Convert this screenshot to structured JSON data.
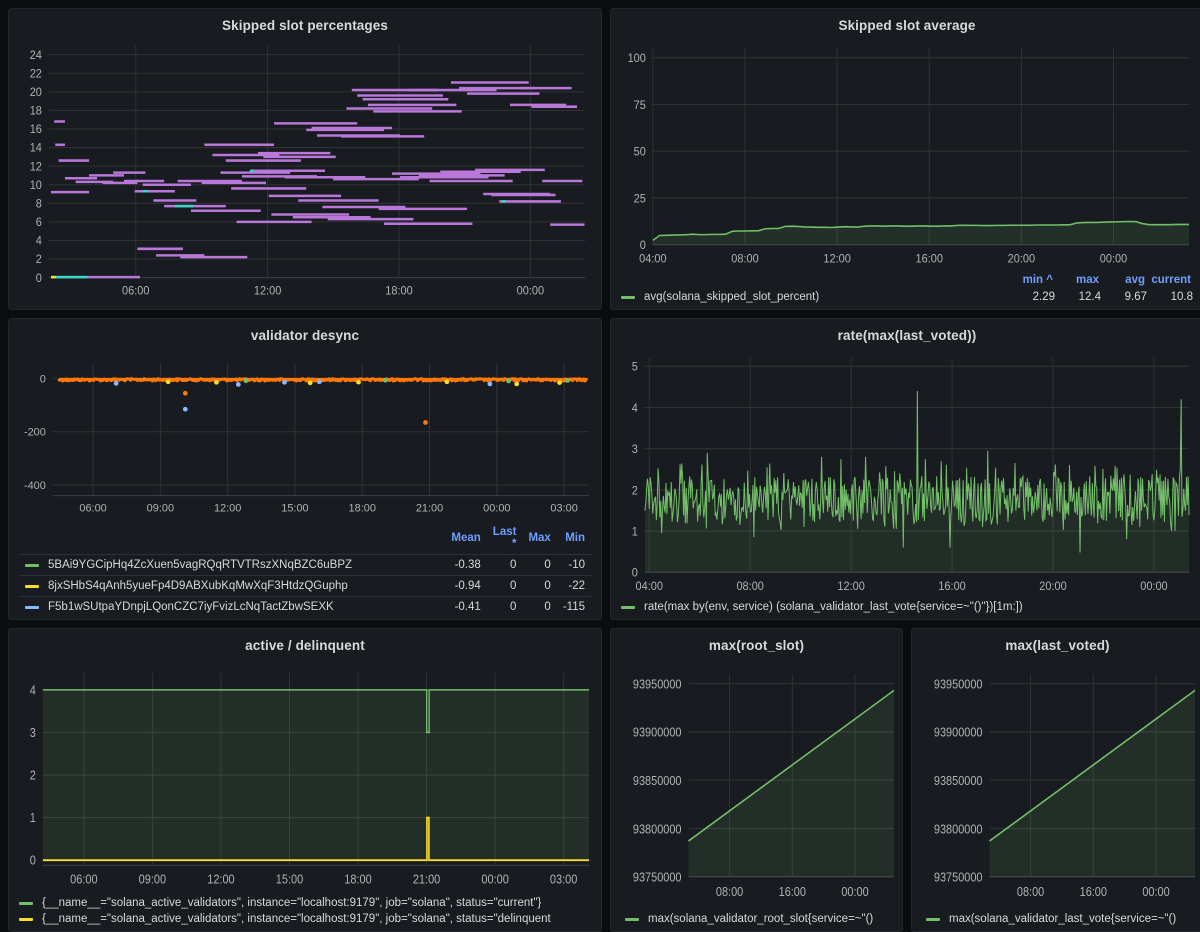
{
  "theme": {
    "page_bg": "#0b0c0e",
    "panel_bg": "#181b1f",
    "text": "#d8d9da",
    "accent_blue": "#6e9fff",
    "green": "#73bf69",
    "yellow": "#fade2a",
    "orange": "#ff780a",
    "blue": "#8ab8ff",
    "purple": "#b877d9",
    "cyan": "#37d9c4"
  },
  "panels": {
    "skipped_slot_percentages": {
      "title": "Skipped slot percentages"
    },
    "skipped_slot_average": {
      "title": "Skipped slot average"
    },
    "validator_desync": {
      "title": "validator desync"
    },
    "rate_max_last_voted": {
      "title": "rate(max(last_voted))"
    },
    "active_delinquent": {
      "title": "active / delinquent"
    },
    "max_root_slot": {
      "title": "max(root_slot)"
    },
    "max_last_voted": {
      "title": "max(last_voted)"
    }
  },
  "legends": {
    "skipped_slot_average": {
      "columns": [
        "min ^",
        "max",
        "avg",
        "current"
      ],
      "series": [
        {
          "label": "avg(solana_skipped_slot_percent)",
          "color": "#73bf69",
          "min": "2.29",
          "max": "12.4",
          "avg": "9.67",
          "current": "10.8"
        }
      ]
    },
    "validator_desync": {
      "columns": [
        "Mean",
        "Last *",
        "Max",
        "Min"
      ],
      "series": [
        {
          "label": "5BAi9YGCipHq4ZcXuen5vagRQqRTVTRszXNqBZC6uBPZ",
          "color": "#73bf69",
          "mean": "-0.38",
          "last": "0",
          "max": "0",
          "min": "-10"
        },
        {
          "label": "8jxSHbS4qAnh5yueFp4D9ABXubKqMwXqF3HtdzQGuphp",
          "color": "#fade2a",
          "mean": "-0.94",
          "last": "0",
          "max": "0",
          "min": "-22"
        },
        {
          "label": "F5b1wSUtpaYDnpjLQonCZC7iyFvizLcNqTactZbwSEXK",
          "color": "#8ab8ff",
          "mean": "-0.41",
          "last": "0",
          "max": "0",
          "min": "-115"
        }
      ]
    },
    "rate_max_last_voted": {
      "series": [
        {
          "label": "rate(max by(env, service) (solana_validator_last_vote{service=~\"()\"})[1m:])",
          "color": "#73bf69"
        }
      ]
    },
    "active_delinquent": {
      "series": [
        {
          "label": "{__name__=\"solana_active_validators\", instance=\"localhost:9179\", job=\"solana\", status=\"current\"}",
          "color": "#73bf69"
        },
        {
          "label": "{__name__=\"solana_active_validators\", instance=\"localhost:9179\", job=\"solana\", status=\"delinquent",
          "color": "#fade2a"
        }
      ]
    },
    "max_root_slot": {
      "series": [
        {
          "label": "max(solana_validator_root_slot{service=~\"()",
          "color": "#73bf69"
        }
      ]
    },
    "max_last_voted": {
      "series": [
        {
          "label": "max(solana_validator_last_vote{service=~\"()",
          "color": "#73bf69"
        }
      ]
    }
  },
  "chart_data": [
    {
      "id": "skipped_slot_percentages",
      "type": "scatter",
      "title": "Skipped slot percentages",
      "xlabel": "",
      "ylabel": "",
      "grid": true,
      "legend": "none",
      "ylim": [
        0,
        25
      ],
      "yticks": [
        0,
        2,
        4,
        6,
        8,
        10,
        12,
        14,
        16,
        18,
        20,
        22,
        24
      ],
      "xticks": [
        "06:00",
        "12:00",
        "18:00",
        "00:00"
      ],
      "xtick_positions": [
        0.162,
        0.408,
        0.653,
        0.898
      ],
      "colors": {
        "primary": "#b877d9",
        "secondary": "#37d9c4",
        "tertiary": "#fade2a"
      },
      "note": "Many short horizontal segments of per-validator skip rate; bulk of mass between 5 and 12 percent, drifting upward to 18-21 after 18:00",
      "series": [
        {
          "name": "band_main",
          "color": "#b877d9",
          "segments": [
            [
              0.004,
              0.075,
              9.2
            ],
            [
              0.01,
              0.03,
              16.8
            ],
            [
              0.012,
              0.03,
              14.3
            ],
            [
              0.018,
              0.075,
              12.6
            ],
            [
              0.03,
              0.09,
              10.7
            ],
            [
              0.05,
              0.12,
              10.3
            ],
            [
              0.075,
              0.14,
              11.0
            ],
            [
              0.1,
              0.165,
              10.2
            ],
            [
              0.12,
              0.18,
              11.3
            ],
            [
              0.14,
              0.215,
              10.4
            ],
            [
              0.16,
              0.235,
              9.3
            ],
            [
              0.165,
              0.25,
              3.1
            ],
            [
              0.175,
              0.265,
              10.0
            ],
            [
              0.195,
              0.275,
              8.3
            ],
            [
              0.2,
              0.29,
              2.4
            ],
            [
              0.215,
              0.33,
              7.7
            ],
            [
              0.24,
              0.36,
              10.4
            ],
            [
              0.245,
              0.37,
              2.2
            ],
            [
              0.265,
              0.395,
              7.2
            ],
            [
              0.285,
              0.405,
              10.2
            ],
            [
              0.29,
              0.42,
              14.3
            ],
            [
              0.305,
              0.43,
              13.2
            ],
            [
              0.32,
              0.45,
              11.3
            ],
            [
              0.33,
              0.47,
              12.6
            ],
            [
              0.34,
              0.48,
              9.6
            ],
            [
              0.35,
              0.49,
              6.0
            ],
            [
              0.36,
              0.5,
              10.9
            ],
            [
              0.375,
              0.515,
              11.5
            ],
            [
              0.39,
              0.525,
              13.4
            ],
            [
              0.4,
              0.535,
              13.0
            ],
            [
              0.41,
              0.545,
              8.8
            ],
            [
              0.415,
              0.56,
              6.8
            ],
            [
              0.42,
              0.575,
              16.6
            ],
            [
              0.44,
              0.59,
              10.8
            ],
            [
              0.455,
              0.6,
              6.5
            ],
            [
              0.465,
              0.615,
              8.3
            ],
            [
              0.48,
              0.625,
              15.9
            ],
            [
              0.49,
              0.64,
              16.1
            ],
            [
              0.5,
              0.655,
              15.3
            ],
            [
              0.51,
              0.665,
              7.6
            ],
            [
              0.52,
              0.68,
              6.3
            ],
            [
              0.53,
              0.69,
              10.6
            ],
            [
              0.545,
              0.7,
              15.2
            ],
            [
              0.555,
              0.715,
              18.2
            ],
            [
              0.565,
              0.725,
              20.2
            ],
            [
              0.575,
              0.735,
              19.6
            ],
            [
              0.585,
              0.745,
              19.2
            ],
            [
              0.595,
              0.76,
              18.6
            ],
            [
              0.605,
              0.77,
              17.9
            ],
            [
              0.615,
              0.78,
              7.4
            ],
            [
              0.625,
              0.79,
              5.8
            ],
            [
              0.64,
              0.805,
              11.2
            ],
            [
              0.655,
              0.82,
              10.8
            ],
            [
              0.67,
              0.835,
              20.2
            ],
            [
              0.69,
              0.85,
              11.0
            ],
            [
              0.71,
              0.865,
              10.4
            ],
            [
              0.73,
              0.88,
              11.4
            ],
            [
              0.75,
              0.895,
              21.0
            ],
            [
              0.765,
              0.905,
              20.4
            ],
            [
              0.78,
              0.915,
              19.8
            ],
            [
              0.795,
              0.925,
              11.6
            ],
            [
              0.81,
              0.935,
              9.0
            ],
            [
              0.825,
              0.945,
              8.9
            ],
            [
              0.84,
              0.955,
              8.2
            ],
            [
              0.86,
              0.965,
              18.6
            ],
            [
              0.88,
              0.975,
              20.4
            ],
            [
              0.9,
              0.985,
              18.4
            ],
            [
              0.92,
              0.995,
              10.4
            ],
            [
              0.935,
              0.999,
              5.7
            ]
          ]
        },
        {
          "name": "zero_line",
          "color": "#b877d9",
          "segments": [
            [
              0.004,
              0.17,
              0.05
            ]
          ]
        },
        {
          "name": "cyan_marks",
          "color": "#37d9c4",
          "segments": [
            [
              0.012,
              0.072,
              0.05
            ],
            [
              0.175,
              0.185,
              9.3
            ],
            [
              0.235,
              0.27,
              7.7
            ],
            [
              0.375,
              0.382,
              11.5
            ],
            [
              0.845,
              0.852,
              8.2
            ]
          ]
        },
        {
          "name": "yellow_marks",
          "color": "#fade2a",
          "segments": [
            [
              0.004,
              0.013,
              0.05
            ]
          ]
        }
      ]
    },
    {
      "id": "skipped_slot_average",
      "type": "area",
      "title": "Skipped slot average",
      "ylim": [
        0,
        105
      ],
      "yticks": [
        0,
        25,
        50,
        75,
        100
      ],
      "xticks": [
        "04:00",
        "08:00",
        "12:00",
        "16:00",
        "20:00",
        "00:00"
      ],
      "grid": true,
      "legend": "bottom",
      "series": [
        {
          "name": "avg(solana_skipped_slot_percent)",
          "color": "#73bf69",
          "values": [
            2.3,
            4.9,
            5.0,
            5.1,
            5.2,
            5.3,
            5.6,
            5.4,
            5.4,
            5.5,
            5.5,
            5.6,
            7.2,
            7.3,
            7.3,
            7.4,
            7.5,
            8.5,
            8.6,
            8.6,
            9.8,
            9.9,
            9.7,
            9.5,
            9.4,
            9.3,
            9.3,
            9.2,
            9.4,
            9.6,
            9.5,
            9.4,
            9.9,
            10.0,
            10.0,
            9.9,
            10.0,
            10.0,
            9.9,
            9.9,
            10.0,
            10.0,
            9.9,
            9.9,
            10.0,
            10.0,
            10.3,
            10.4,
            10.3,
            10.3,
            10.2,
            10.2,
            10.3,
            10.3,
            10.4,
            10.4,
            10.4,
            10.4,
            10.5,
            10.5,
            10.5,
            10.5,
            10.6,
            10.6,
            11.6,
            11.8,
            11.9,
            11.9,
            12.0,
            12.1,
            12.2,
            12.3,
            12.4,
            12.3,
            11.2,
            10.7,
            10.7,
            10.7,
            10.7,
            10.8,
            10.8,
            10.8
          ]
        }
      ]
    },
    {
      "id": "validator_desync",
      "type": "scatter",
      "title": "validator desync",
      "ylim": [
        -440,
        60
      ],
      "yticks": [
        0,
        -200,
        -400
      ],
      "xticks": [
        "06:00",
        "09:00",
        "12:00",
        "15:00",
        "18:00",
        "21:00",
        "00:00",
        "03:00"
      ],
      "grid": true,
      "legend": "table",
      "note": "Dense orange band of near-zero values along y=0 with sparse negative outliers",
      "series": [
        {
          "name": "5BAi9YGCipHq4ZcXuen5vagRQqRTVTRszXNqBZC6uBPZ",
          "color": "#73bf69",
          "outliers": [
            [
              0.36,
              -8
            ],
            [
              0.62,
              -6
            ],
            [
              0.85,
              -9
            ],
            [
              0.96,
              -7
            ]
          ]
        },
        {
          "name": "8jxSHbS4qAnh5yueFp4D9ABXubKqMwXqF3HtdzQGuphp",
          "color": "#fade2a",
          "outliers": [
            [
              0.215,
              -12
            ],
            [
              0.305,
              -14
            ],
            [
              0.48,
              -16
            ],
            [
              0.57,
              -13
            ],
            [
              0.735,
              -12
            ],
            [
              0.865,
              -20
            ],
            [
              0.945,
              -15
            ]
          ]
        },
        {
          "name": "F5b1wSUtpaYDnpjLQonCZC7iyFvizLcNqTactZbwSEXK",
          "color": "#8ab8ff",
          "outliers": [
            [
              0.118,
              -18
            ],
            [
              0.247,
              -115
            ],
            [
              0.346,
              -22
            ],
            [
              0.432,
              -14
            ],
            [
              0.497,
              -12
            ],
            [
              0.815,
              -20
            ]
          ]
        },
        {
          "name": "dense_band",
          "color": "#ff780a",
          "outliers": [
            [
              0.247,
              -55
            ],
            [
              0.695,
              -165
            ]
          ]
        }
      ]
    },
    {
      "id": "rate_max_last_voted",
      "type": "area",
      "title": "rate(max(last_voted))",
      "ylim": [
        0,
        5.2
      ],
      "yticks": [
        0,
        1,
        2,
        3,
        4,
        5
      ],
      "xticks": [
        "04:00",
        "08:00",
        "12:00",
        "16:00",
        "20:00",
        "00:00"
      ],
      "grid": true,
      "legend": "bottom",
      "note": "High-frequency noise oscillating around 1.8 with occasional spikes to 2.9-4.4",
      "series": [
        {
          "name": "rate(max by(env, service) (solana_validator_last_vote{service=~\"()\"})[1m:])",
          "color": "#73bf69",
          "mean": 1.8,
          "noise_band": [
            1.25,
            2.35
          ],
          "spikes": [
            [
              0.115,
              2.9
            ],
            [
              0.225,
              2.55
            ],
            [
              0.325,
              2.8
            ],
            [
              0.36,
              2.75
            ],
            [
              0.405,
              2.8
            ],
            [
              0.5,
              4.4
            ],
            [
              0.515,
              2.75
            ],
            [
              0.545,
              2.7
            ],
            [
              0.63,
              2.95
            ],
            [
              0.68,
              2.65
            ],
            [
              0.78,
              2.6
            ],
            [
              0.985,
              4.2
            ]
          ],
          "dips": [
            [
              0.03,
              0.95
            ],
            [
              0.175,
              1.15
            ],
            [
              0.2,
              0.85
            ],
            [
              0.475,
              0.6
            ],
            [
              0.56,
              0.6
            ],
            [
              0.8,
              0.48
            ],
            [
              0.885,
              0.8
            ]
          ]
        }
      ]
    },
    {
      "id": "active_delinquent",
      "type": "line",
      "title": "active / delinquent",
      "ylim": [
        -0.12,
        4.4
      ],
      "yticks": [
        0,
        1,
        2,
        3,
        4
      ],
      "xticks": [
        "06:00",
        "09:00",
        "12:00",
        "15:00",
        "18:00",
        "21:00",
        "00:00",
        "03:00"
      ],
      "grid": true,
      "legend": "bottom",
      "series": [
        {
          "name": "current",
          "color": "#73bf69",
          "base": 4,
          "dip_x": 0.705,
          "dip_value": 3
        },
        {
          "name": "delinquent",
          "color": "#fade2a",
          "base": 0,
          "spike_x": 0.705,
          "spike_value": 1
        }
      ]
    },
    {
      "id": "max_root_slot",
      "type": "area",
      "title": "max(root_slot)",
      "ylim": [
        93750000,
        93960000
      ],
      "yticks": [
        93750000,
        93800000,
        93850000,
        93900000,
        93950000
      ],
      "ytick_labels": [
        "93750000",
        "93800000",
        "93850000",
        "93900000",
        "93950000"
      ],
      "xticks": [
        "08:00",
        "16:00",
        "00:00"
      ],
      "grid": true,
      "legend": "bottom",
      "series": [
        {
          "name": "max(solana_validator_root_slot{service=~\"()",
          "color": "#73bf69",
          "start": 93787000,
          "end": 93943000,
          "shape": "linear-increasing"
        }
      ]
    },
    {
      "id": "max_last_voted",
      "type": "area",
      "title": "max(last_voted)",
      "ylim": [
        93750000,
        93960000
      ],
      "yticks": [
        93750000,
        93800000,
        93850000,
        93900000,
        93950000
      ],
      "ytick_labels": [
        "93750000",
        "93800000",
        "93850000",
        "93900000",
        "93950000"
      ],
      "xticks": [
        "08:00",
        "16:00",
        "00:00"
      ],
      "grid": true,
      "legend": "bottom",
      "series": [
        {
          "name": "max(solana_validator_last_vote{service=~\"()",
          "color": "#73bf69",
          "start": 93787000,
          "end": 93943000,
          "shape": "linear-increasing"
        }
      ]
    }
  ]
}
